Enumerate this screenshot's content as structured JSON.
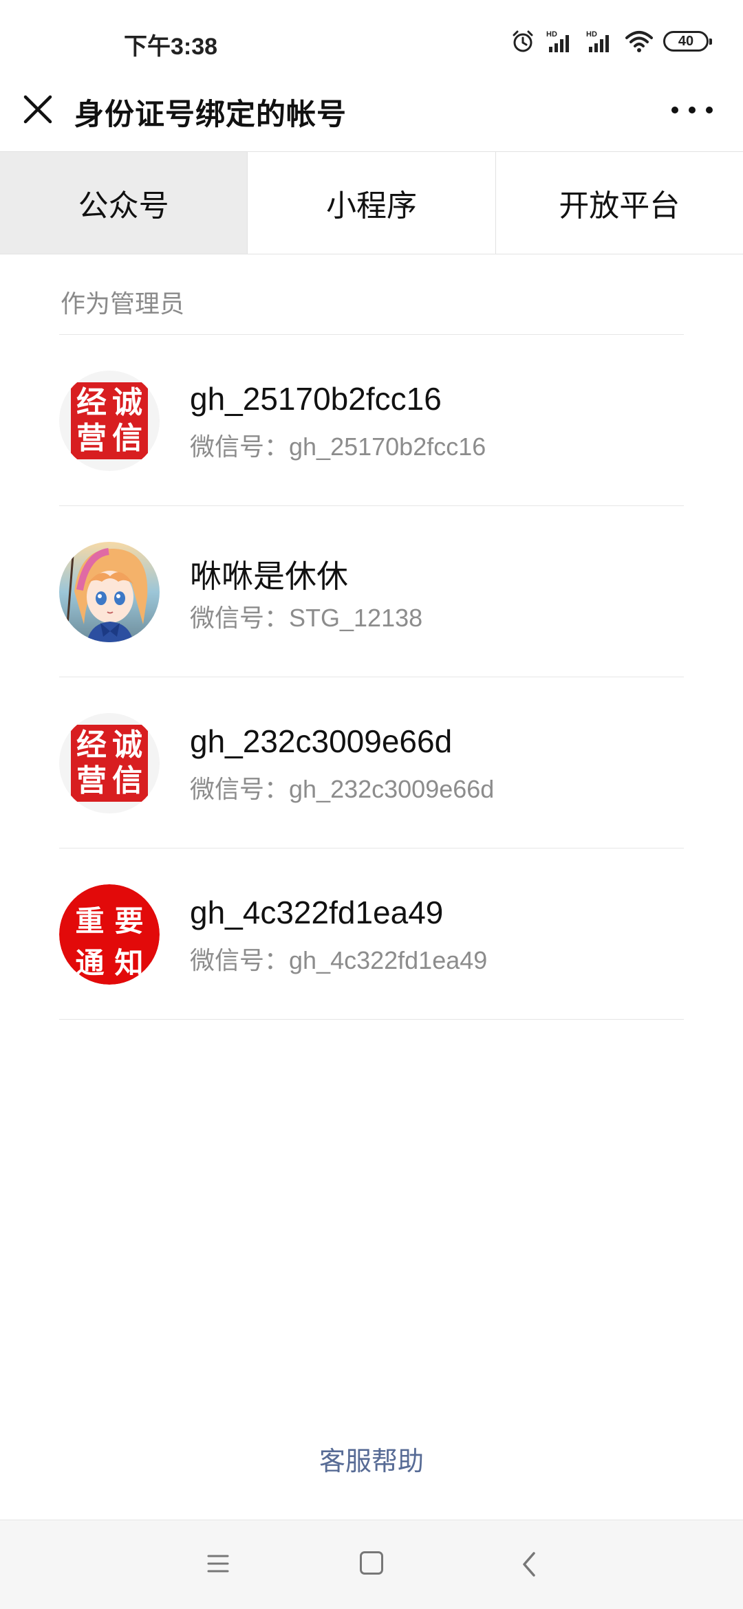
{
  "status_bar": {
    "time": "下午3:38",
    "battery": "40",
    "icons": [
      "alarm-icon",
      "hd-signal-icon",
      "hd-signal-icon",
      "wifi-icon",
      "battery-icon"
    ]
  },
  "header": {
    "title": "身份证号绑定的帐号",
    "close_icon": "close-icon",
    "more_icon": "more-icon"
  },
  "tabs": [
    {
      "label": "公众号",
      "active": true
    },
    {
      "label": "小程序",
      "active": false
    },
    {
      "label": "开放平台",
      "active": false
    }
  ],
  "section": {
    "label": "作为管理员"
  },
  "accounts": [
    {
      "name": "gh_25170b2fcc16",
      "wechat_id": "微信号：gh_25170b2fcc16",
      "avatar": "seal",
      "avatar_text": [
        "经",
        "诚",
        "营",
        "信"
      ]
    },
    {
      "name": "咻咻是休休",
      "wechat_id": "微信号：STG_12138",
      "avatar": "anime-girl"
    },
    {
      "name": "gh_232c3009e66d",
      "wechat_id": "微信号：gh_232c3009e66d",
      "avatar": "seal",
      "avatar_text": [
        "经",
        "诚",
        "营",
        "信"
      ]
    },
    {
      "name": "gh_4c322fd1ea49",
      "wechat_id": "微信号：gh_4c322fd1ea49",
      "avatar": "notice",
      "avatar_text": [
        "重",
        "要",
        "通",
        "知"
      ]
    }
  ],
  "footer": {
    "help_label": "客服帮助"
  },
  "nav_bar": {
    "icons": [
      "menu-icon",
      "home-icon",
      "back-icon"
    ]
  },
  "colors": {
    "active_tab_bg": "#ececec",
    "link": "#576b95",
    "seal_red": "#d81e20"
  }
}
